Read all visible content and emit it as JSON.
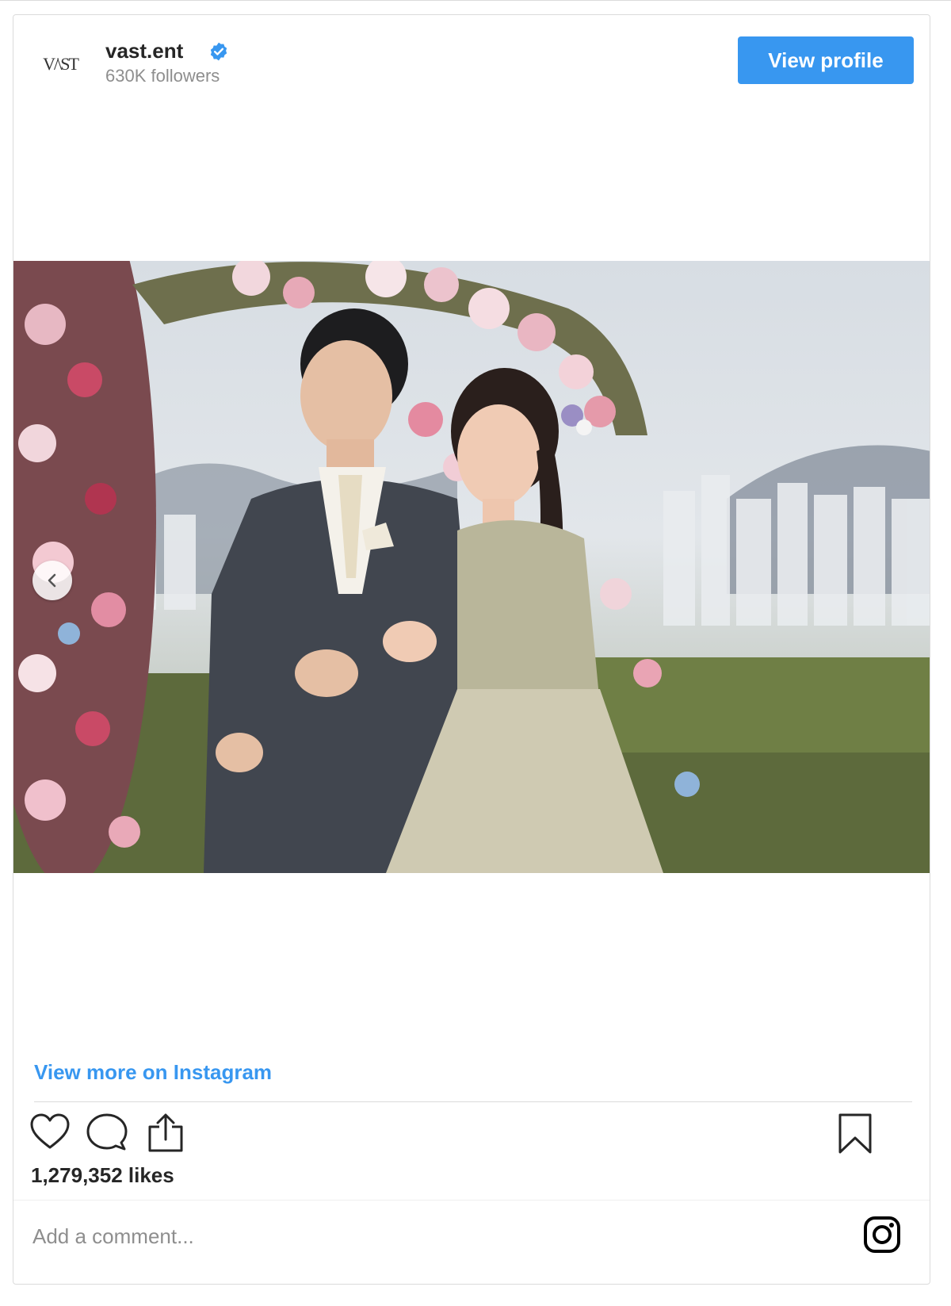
{
  "profile": {
    "logo_text": "V/\\ST",
    "username": "vast.ent",
    "followers": "630K followers",
    "view_profile_label": "View profile",
    "verified_color": "#3897f0"
  },
  "post": {
    "image_alt": "Wedding portrait of a couple in front of a floral arch",
    "view_more_label": "View more on Instagram",
    "likes": "1,279,352 likes",
    "comment_placeholder": "Add a comment..."
  },
  "icons": {
    "like": "heart-icon",
    "comment": "comment-bubble-icon",
    "share": "share-icon",
    "save": "bookmark-icon",
    "carousel_prev": "chevron-left-icon",
    "brand": "instagram-icon"
  },
  "colors": {
    "accent": "#3897f0",
    "text": "#262626",
    "muted": "#8e8e8e",
    "border": "#dbdbdb"
  }
}
